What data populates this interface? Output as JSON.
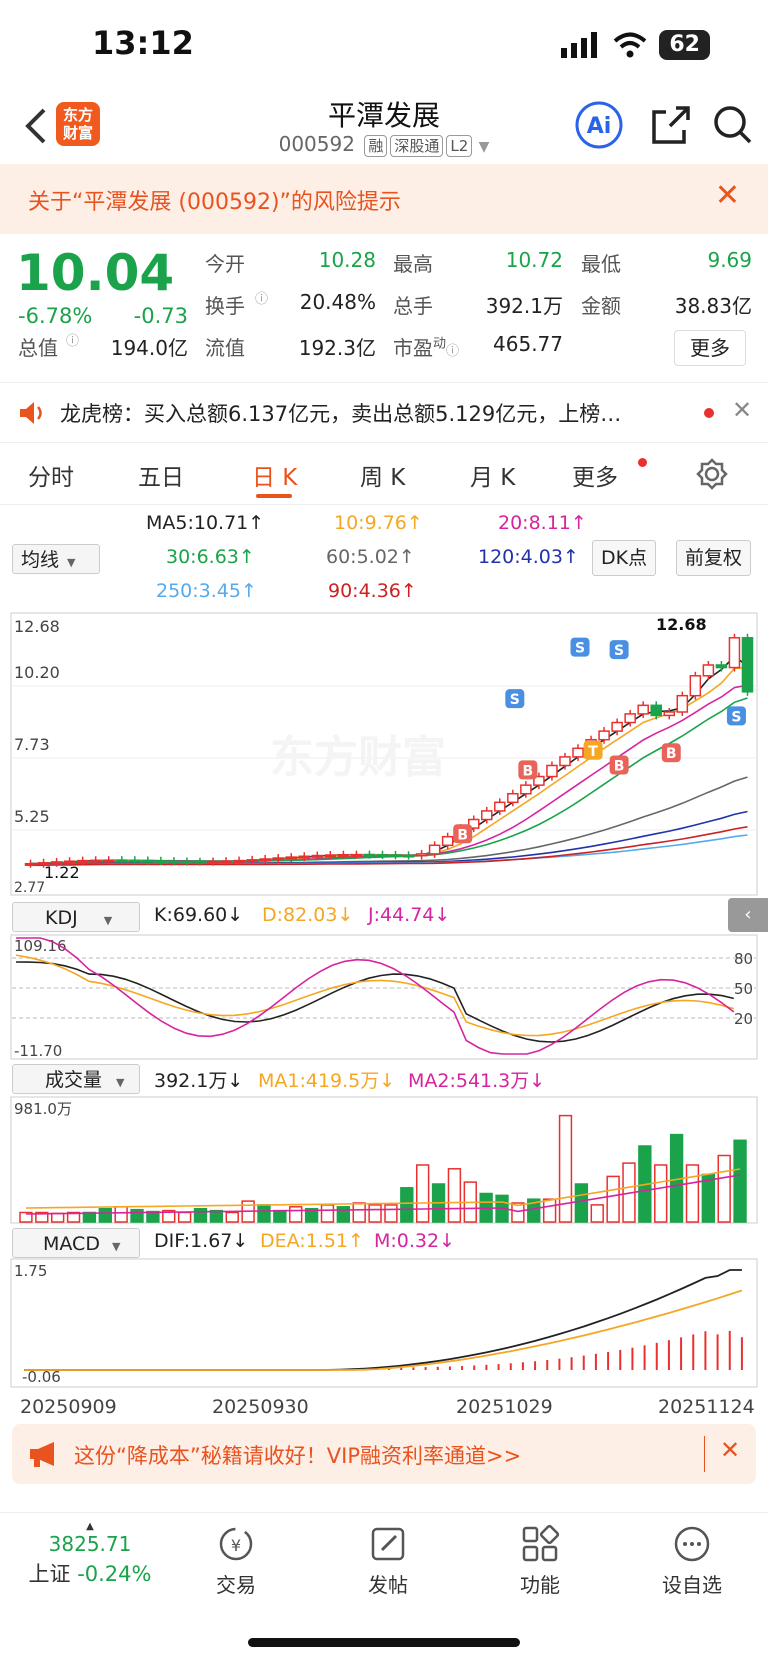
{
  "status": {
    "time": "13:12",
    "battery": "62"
  },
  "header": {
    "title": "平潭发展",
    "code": "000592",
    "tags": [
      "融",
      "深股通",
      "L2"
    ],
    "logo": "东方\n财富",
    "ai_label": "Ai"
  },
  "risk_banner": {
    "text": "关于“平潭发展 (000592)”的风险提示"
  },
  "quote": {
    "price": "10.04",
    "change_pct": "-6.78%",
    "change": "-0.73",
    "stats": [
      {
        "label": "今开",
        "value": "10.28",
        "color": "#1aa34a"
      },
      {
        "label": "最高",
        "value": "10.72",
        "color": "#1aa34a"
      },
      {
        "label": "最低",
        "value": "9.69",
        "color": "#1aa34a"
      },
      {
        "label": "换手",
        "value": "20.48%"
      },
      {
        "label": "总手",
        "value": "392.1万"
      },
      {
        "label": "金额",
        "value": "38.83亿"
      },
      {
        "label": "总值",
        "value": "194.0亿"
      },
      {
        "label": "流值",
        "value": "192.3亿"
      },
      {
        "label": "市盈",
        "value": "465.77",
        "sup": "动"
      }
    ],
    "more_label": "更多"
  },
  "longhu": {
    "text": "龙虎榜：买入总额6.137亿元，卖出总额5.129亿元，上榜…"
  },
  "tabs": [
    "分时",
    "五日",
    "日 K",
    "周 K",
    "月 K",
    "更多"
  ],
  "active_tab": 2,
  "ma": {
    "selector": "均线",
    "items": [
      {
        "label": "MA5:10.71",
        "arrow": "↑",
        "color": "#222"
      },
      {
        "label": "10:9.76",
        "arrow": "↑",
        "color": "#f5a623"
      },
      {
        "label": "20:8.11",
        "arrow": "↑",
        "color": "#d6249f"
      },
      {
        "label": "30:6.63",
        "arrow": "↑",
        "color": "#1aa34a"
      },
      {
        "label": "60:5.02",
        "arrow": "↑",
        "color": "#666"
      },
      {
        "label": "120:4.03",
        "arrow": "↑",
        "color": "#2233aa"
      },
      {
        "label": "250:3.45",
        "arrow": "↑",
        "color": "#55aaee"
      },
      {
        "label": "90:4.36",
        "arrow": "↑",
        "color": "#cc2222"
      }
    ],
    "dk_label": "DK点",
    "fq_label": "前复权"
  },
  "kline": {
    "y_labels": [
      "12.68",
      "10.20",
      "7.73",
      "5.25",
      "2.77"
    ],
    "high_mark": "12.68",
    "low_mark": "1.22",
    "watermark": "东方财富"
  },
  "kdj": {
    "selector": "KDJ",
    "k": "K:69.60",
    "d": "D:82.03",
    "j": "J:44.74",
    "top": "109.16",
    "bottom": "-11.70",
    "levels": [
      "80",
      "50",
      "20"
    ],
    "arrow": "↓"
  },
  "volume": {
    "selector": "成交量",
    "value": "392.1万",
    "ma1": "MA1:419.5万",
    "ma2": "MA2:541.3万",
    "top": "981.0万",
    "arrow": "↓"
  },
  "macd": {
    "selector": "MACD",
    "dif": "DIF:1.67",
    "dea": "DEA:1.51",
    "m": "M:0.32",
    "top": "1.75",
    "bottom": "-0.06",
    "dif_arrow": "↓",
    "dea_arrow": "↑",
    "m_arrow": "↓"
  },
  "dates": [
    "20250909",
    "20250930",
    "20251029",
    "20251124"
  ],
  "bottom_banner": {
    "text": "这份“降成本”秘籍请收好！VIP融资利率通道>>"
  },
  "nav": {
    "index_value": "3825.71",
    "index_name": "上证",
    "index_change": "-0.24%",
    "items": [
      "交易",
      "发帖",
      "功能",
      "设自选"
    ]
  },
  "colors": {
    "up": "#e8312f",
    "down": "#1aa34a",
    "accent": "#e8531e"
  }
}
